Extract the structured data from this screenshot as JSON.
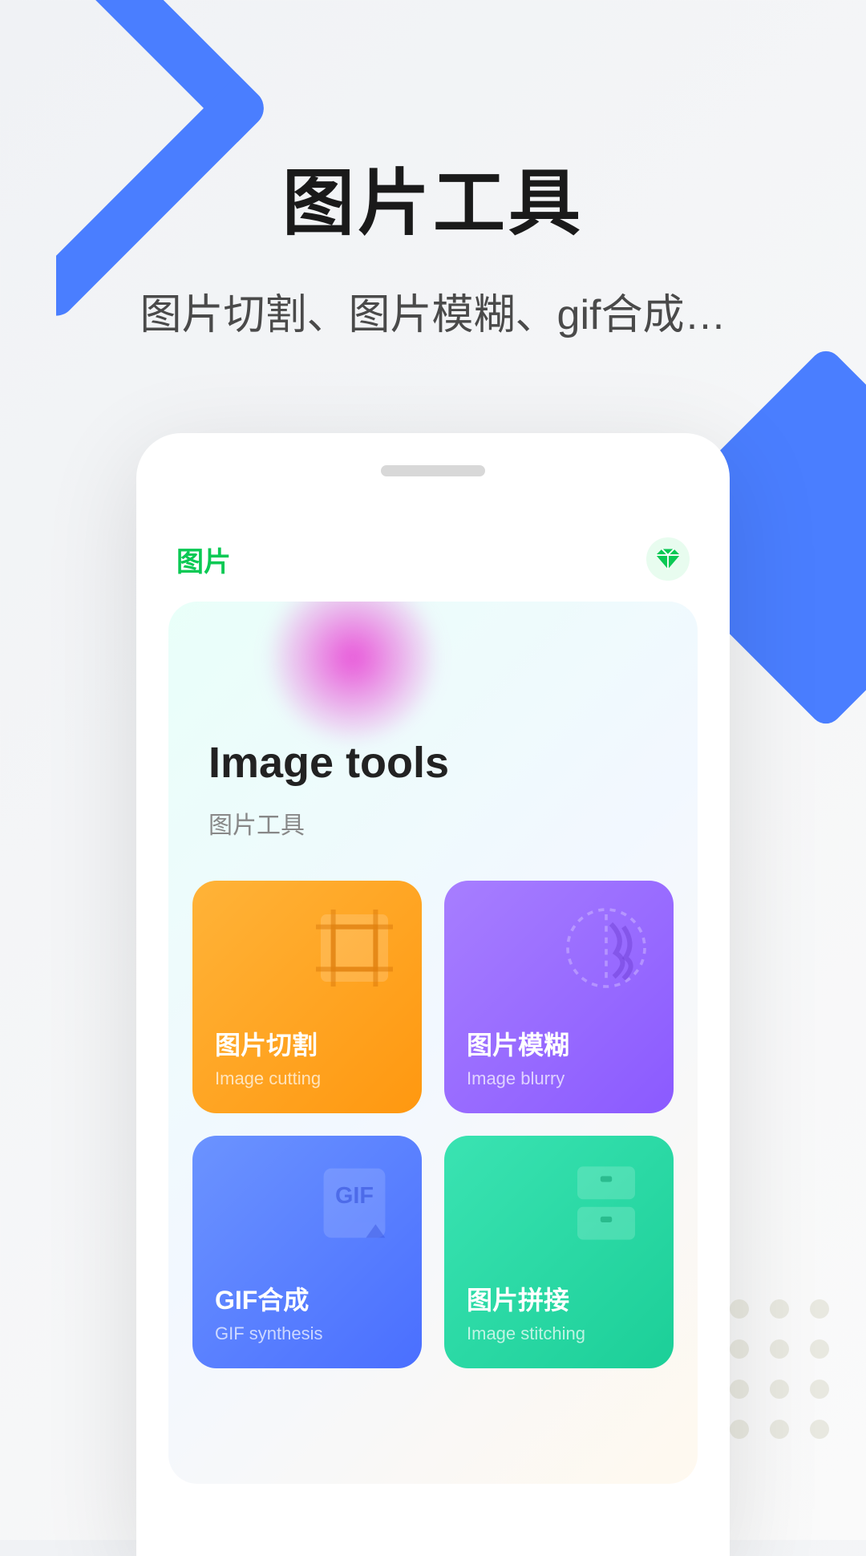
{
  "header": {
    "title": "图片工具",
    "subtitle": "图片切割、图片模糊、gif合成…"
  },
  "app": {
    "tab_label": "图片",
    "badge_icon": "diamond-icon"
  },
  "hero": {
    "title_en": "Image tools",
    "title_cn": "图片工具"
  },
  "tiles": [
    {
      "title": "图片切割",
      "sub": "Image cutting",
      "color": "orange",
      "icon": "crop-icon"
    },
    {
      "title": "图片模糊",
      "sub": "Image blurry",
      "color": "purple",
      "icon": "blur-icon"
    },
    {
      "title": "GIF合成",
      "sub": "GIF synthesis",
      "color": "blue",
      "icon": "gif-icon"
    },
    {
      "title": "图片拼接",
      "sub": "Image stitching",
      "color": "green",
      "icon": "stitch-icon"
    }
  ]
}
